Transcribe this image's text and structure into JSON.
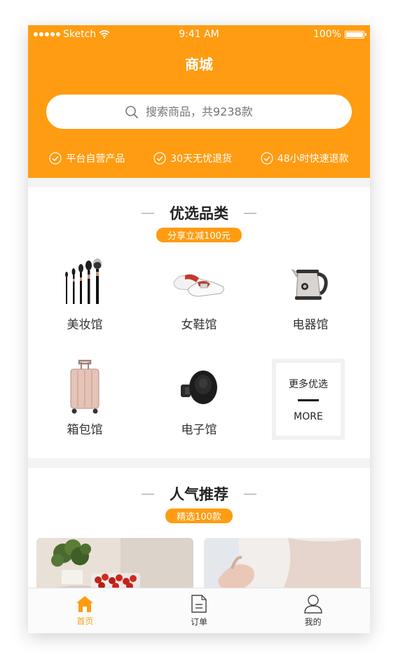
{
  "status_bar": {
    "carrier": "Sketch",
    "time": "9:41 AM",
    "battery": "100%"
  },
  "header": {
    "title": "商城",
    "search_placeholder": "搜索商品，共9238款",
    "features": [
      "平台自营产品",
      "30天无忧退货",
      "48小时快速退款"
    ]
  },
  "categories_section": {
    "title": "优选品类",
    "badge": "分享立减100元",
    "items": [
      {
        "label": "美妆馆",
        "icon": "makeup-brushes-icon"
      },
      {
        "label": "女鞋馆",
        "icon": "womens-shoes-icon"
      },
      {
        "label": "电器馆",
        "icon": "electric-kettle-icon"
      },
      {
        "label": "箱包馆",
        "icon": "luggage-icon"
      },
      {
        "label": "电子馆",
        "icon": "electronics-mount-icon"
      }
    ],
    "more": {
      "title": "更多优选",
      "subtitle": "MORE"
    }
  },
  "popular_section": {
    "title": "人气推荐",
    "badge": "精选100款"
  },
  "tabbar": {
    "items": [
      {
        "label": "首页",
        "icon": "home-icon",
        "active": true
      },
      {
        "label": "订单",
        "icon": "document-icon",
        "active": false
      },
      {
        "label": "我的",
        "icon": "user-icon",
        "active": false
      }
    ]
  },
  "colors": {
    "accent": "#ff9c11",
    "background": "#f4f4f4",
    "text": "#222222"
  }
}
